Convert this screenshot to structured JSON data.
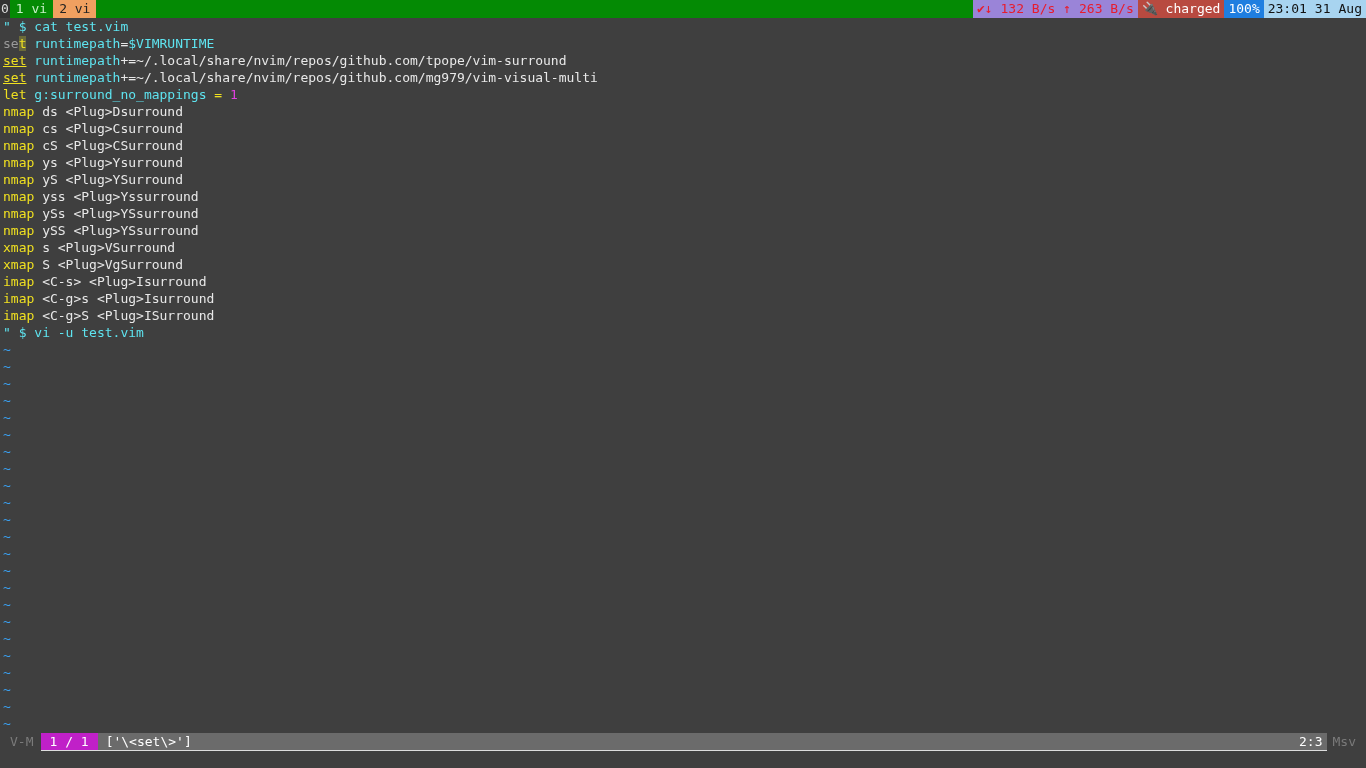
{
  "tmux_bar": {
    "session": "0",
    "windows": [
      {
        "label": "1 vi",
        "selected": false
      },
      {
        "label": "2 vi",
        "selected": true
      }
    ],
    "status": [
      {
        "kind": "net",
        "text": "✔↓ 132 B/s"
      },
      {
        "kind": "net",
        "text": "↑ 263 B/s"
      },
      {
        "kind": "battery",
        "text": "🔌 charged"
      },
      {
        "kind": "volume",
        "text": "100%"
      },
      {
        "kind": "clock",
        "text": "23:01"
      },
      {
        "kind": "clock",
        "text": "31"
      },
      {
        "kind": "clock",
        "text": "Aug"
      }
    ]
  },
  "buffer": {
    "lines": [
      [
        {
          "kind": "comment",
          "text": "\" $ cat test.vim"
        }
      ],
      [
        {
          "kind": "dim",
          "text": "se"
        },
        {
          "kind": "cursor",
          "text": "t"
        },
        {
          "kind": "option",
          "text": " runtimepath"
        },
        {
          "kind": "plain",
          "text": "="
        },
        {
          "kind": "option",
          "text": "$VIMRUNTIME"
        }
      ],
      [
        {
          "kind": "match",
          "text": "set"
        },
        {
          "kind": "option",
          "text": " runtimepath"
        },
        {
          "kind": "plain",
          "text": "+=~/.local/share/nvim/repos/github.com/tpope/vim-surround"
        }
      ],
      [
        {
          "kind": "match",
          "text": "set"
        },
        {
          "kind": "option",
          "text": " runtimepath"
        },
        {
          "kind": "plain",
          "text": "+=~/.local/share/nvim/repos/github.com/mg979/vim-visual-multi"
        }
      ],
      [
        {
          "kind": "keyword",
          "text": "let"
        },
        {
          "kind": "option",
          "text": " g:surround_no_mappings"
        },
        {
          "kind": "keyword",
          "text": " ="
        },
        {
          "kind": "number",
          "text": " 1"
        }
      ],
      [
        {
          "kind": "keyword",
          "text": "nmap"
        },
        {
          "kind": "plain",
          "text": " ds <Plug>Dsurround"
        }
      ],
      [
        {
          "kind": "keyword",
          "text": "nmap"
        },
        {
          "kind": "plain",
          "text": " cs <Plug>Csurround"
        }
      ],
      [
        {
          "kind": "keyword",
          "text": "nmap"
        },
        {
          "kind": "plain",
          "text": " cS <Plug>CSurround"
        }
      ],
      [
        {
          "kind": "keyword",
          "text": "nmap"
        },
        {
          "kind": "plain",
          "text": " ys <Plug>Ysurround"
        }
      ],
      [
        {
          "kind": "keyword",
          "text": "nmap"
        },
        {
          "kind": "plain",
          "text": " yS <Plug>YSurround"
        }
      ],
      [
        {
          "kind": "keyword",
          "text": "nmap"
        },
        {
          "kind": "plain",
          "text": " yss <Plug>Yssurround"
        }
      ],
      [
        {
          "kind": "keyword",
          "text": "nmap"
        },
        {
          "kind": "plain",
          "text": " ySs <Plug>YSsurround"
        }
      ],
      [
        {
          "kind": "keyword",
          "text": "nmap"
        },
        {
          "kind": "plain",
          "text": " ySS <Plug>YSsurround"
        }
      ],
      [
        {
          "kind": "keyword",
          "text": "xmap"
        },
        {
          "kind": "plain",
          "text": " s <Plug>VSurround"
        }
      ],
      [
        {
          "kind": "keyword",
          "text": "xmap"
        },
        {
          "kind": "plain",
          "text": " S <Plug>VgSurround"
        }
      ],
      [
        {
          "kind": "keyword",
          "text": "imap"
        },
        {
          "kind": "plain",
          "text": " <C-s> <Plug>Isurround"
        }
      ],
      [
        {
          "kind": "keyword",
          "text": "imap"
        },
        {
          "kind": "plain",
          "text": " <C-g>s <Plug>Isurround"
        }
      ],
      [
        {
          "kind": "keyword",
          "text": "imap"
        },
        {
          "kind": "plain",
          "text": " <C-g>S <Plug>ISurround"
        }
      ],
      [
        {
          "kind": "comment",
          "text": "\" $ vi -u test.vim"
        }
      ]
    ],
    "filler": [
      "~",
      "~",
      "~",
      "~",
      "~",
      "~",
      "~",
      "~",
      "~",
      "~",
      "~",
      "~",
      "~",
      "~",
      "~",
      "~",
      "~",
      "~",
      "~",
      "~",
      "~",
      "~",
      "~"
    ]
  },
  "statusline": {
    "mode": "V-M",
    "index": "1 / 1",
    "pattern": "['\\<set\\>']",
    "position": "2:3",
    "right": "Msv"
  }
}
